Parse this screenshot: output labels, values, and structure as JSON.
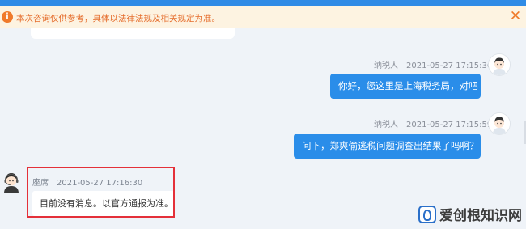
{
  "notice": {
    "icon": "info-icon",
    "text": "本次咨询仅供参考，具体以法律法规及相关规定为准。",
    "close_glyph": "✕"
  },
  "messages": [
    {
      "role": "user",
      "sender": "纳税人",
      "time": "2021-05-27 17:15:36",
      "text": "你好，您这里是上海税务局，对吧"
    },
    {
      "role": "user",
      "sender": "纳税人",
      "time": "2021-05-27 17:15:59",
      "text": "问下，郑爽偷逃税问题调查出结果了吗啊？"
    },
    {
      "role": "agent",
      "sender": "座席",
      "time": "2021-05-27 17:16:30",
      "text": "目前没有消息。以官方通报为准。"
    }
  ],
  "colors": {
    "accent": "#2a8de9",
    "notice_text": "#e56d2c",
    "highlight": "#e43039"
  },
  "watermark": {
    "text": "爱创根知识网"
  }
}
